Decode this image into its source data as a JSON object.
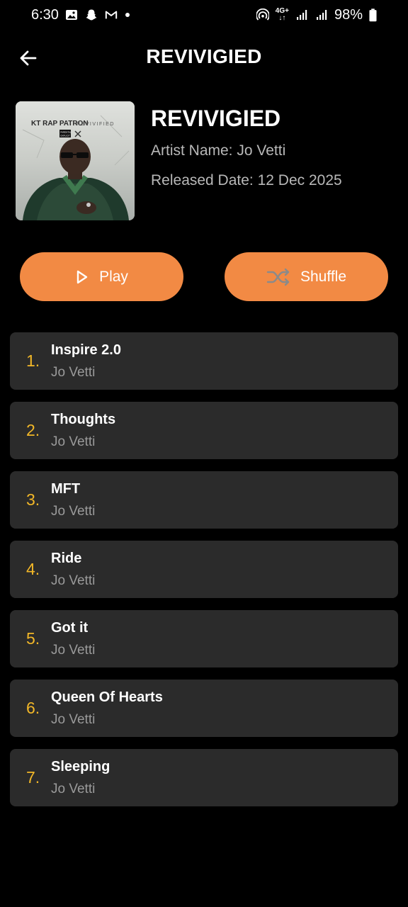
{
  "status_bar": {
    "time": "6:30",
    "network_label": "4G+",
    "battery": "98%"
  },
  "header": {
    "title": "REVIVIGIED"
  },
  "album": {
    "title": "REVIVIGIED",
    "artist": "Artist Name: Jo Vetti",
    "release": "Released Date: 12 Dec 2025",
    "cover_text": {
      "brand": "KT RAP PATRON",
      "album": "REVIVIFIED",
      "advisory_top": "PARENTAL",
      "advisory_bottom": "EXPLICIT"
    }
  },
  "actions": {
    "play_label": "Play",
    "shuffle_label": "Shuffle"
  },
  "tracks": [
    {
      "num": "1.",
      "title": "Inspire 2.0",
      "artist": "Jo Vetti"
    },
    {
      "num": "2.",
      "title": "Thoughts",
      "artist": "Jo Vetti"
    },
    {
      "num": "3.",
      "title": "MFT",
      "artist": "Jo Vetti"
    },
    {
      "num": "4.",
      "title": "Ride",
      "artist": "Jo Vetti"
    },
    {
      "num": "5.",
      "title": "Got it",
      "artist": "Jo Vetti"
    },
    {
      "num": "6.",
      "title": "Queen Of Hearts",
      "artist": "Jo Vetti"
    },
    {
      "num": "7.",
      "title": "Sleeping",
      "artist": "Jo Vetti"
    }
  ],
  "colors": {
    "background": "#000000",
    "accent": "#f28a44",
    "track_number": "#f2b728",
    "card": "#2b2b2b"
  }
}
